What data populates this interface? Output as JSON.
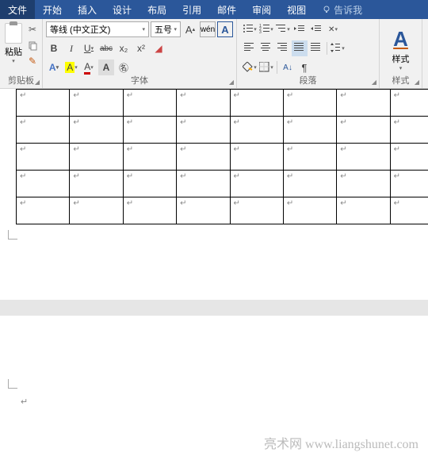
{
  "tabs": {
    "file": "文件",
    "home": "开始",
    "insert": "插入",
    "design": "设计",
    "layout": "布局",
    "references": "引用",
    "mailings": "邮件",
    "review": "审阅",
    "view": "视图",
    "tell_me": "告诉我"
  },
  "clipboard": {
    "paste": "粘贴",
    "label": "剪贴板"
  },
  "font": {
    "name": "等线 (中文正文)",
    "size": "五号",
    "label": "字体",
    "bold": "B",
    "italic": "I",
    "underline": "U",
    "strike": "abc",
    "sub": "x₂",
    "sup": "x²",
    "wen": "wén",
    "charA_box": "A",
    "grow": "A",
    "shrink": "A",
    "clear": "A",
    "highlight": "A",
    "color": "A"
  },
  "paragraph": {
    "label": "段落"
  },
  "styles": {
    "label": "样式",
    "icon": "A"
  },
  "table": {
    "rows": 5,
    "cols": 8,
    "cell_mark": "↵"
  },
  "watermark": "亮术网 www.liangshunet.com"
}
